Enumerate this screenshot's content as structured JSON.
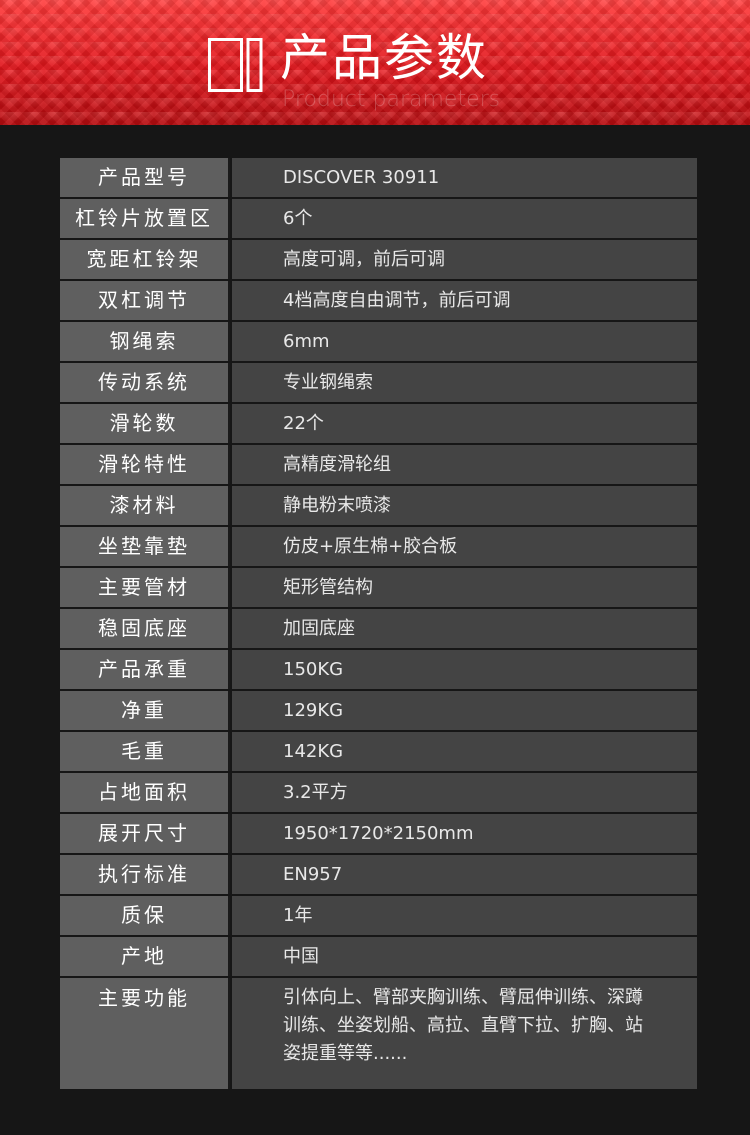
{
  "header": {
    "title": "产品参数",
    "subtitle": "Product parameters"
  },
  "specs": [
    {
      "label": "产品型号",
      "value": "DISCOVER 30911"
    },
    {
      "label": "杠铃片放置区",
      "value": "6个"
    },
    {
      "label": "宽距杠铃架",
      "value": "高度可调，前后可调"
    },
    {
      "label": "双杠调节",
      "value": "4档高度自由调节，前后可调"
    },
    {
      "label": "钢绳索",
      "value": "6mm"
    },
    {
      "label": "传动系统",
      "value": "专业钢绳索"
    },
    {
      "label": "滑轮数",
      "value": "22个"
    },
    {
      "label": "滑轮特性",
      "value": "高精度滑轮组"
    },
    {
      "label": "漆材料",
      "value": "静电粉末喷漆"
    },
    {
      "label": "坐垫靠垫",
      "value": "仿皮+原生棉+胶合板"
    },
    {
      "label": "主要管材",
      "value": "矩形管结构"
    },
    {
      "label": "稳固底座",
      "value": "加固底座"
    },
    {
      "label": "产品承重",
      "value": "150KG"
    },
    {
      "label": "净重",
      "value": "129KG"
    },
    {
      "label": "毛重",
      "value": "142KG"
    },
    {
      "label": "占地面积",
      "value": "3.2平方"
    },
    {
      "label": "展开尺寸",
      "value": "1950*1720*2150mm"
    },
    {
      "label": "执行标准",
      "value": "EN957"
    },
    {
      "label": "质保",
      "value": "1年"
    },
    {
      "label": "产地",
      "value": "中国"
    },
    {
      "label": "主要功能",
      "value": "引体向上、臂部夹胸训练、臂屈伸训练、深蹲训练、坐姿划船、高拉、直臂下拉、扩胸、站姿提重等等......"
    }
  ]
}
